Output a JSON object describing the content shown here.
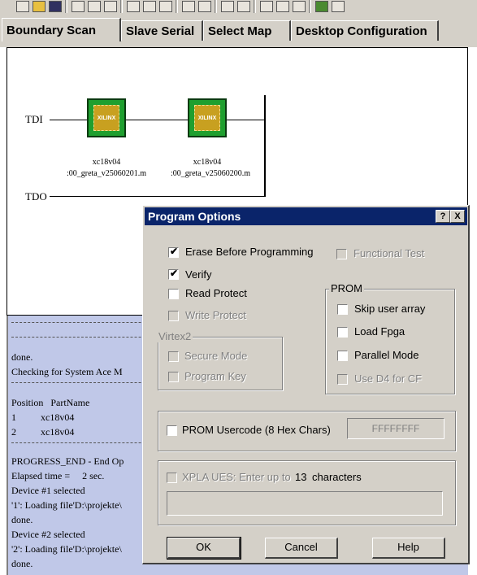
{
  "tabs": [
    "Boundary Scan",
    "Slave Serial",
    "Select Map",
    "Desktop Configuration"
  ],
  "chain": {
    "tdi": "TDI",
    "tdo": "TDO",
    "devices": [
      {
        "chip_logo": "XILINX",
        "part": "xc18v04",
        "file": ":00_greta_v25060201.m"
      },
      {
        "chip_logo": "XILINX",
        "part": "xc18v04",
        "file": ":00_greta_v25060200.m"
      }
    ]
  },
  "output": {
    "lines": [
      "done.",
      "Checking for System Ace M",
      "Position   PartName",
      "1          xc18v04",
      "2          xc18v04",
      "PROGRESS_END - End Op",
      "Elapsed time =     2 sec.",
      "Device #1 selected",
      "'1': Loading file'D:\\projekte\\",
      "done.",
      "Device #2 selected",
      "'2': Loading file'D:\\projekte\\",
      "done."
    ]
  },
  "dialog": {
    "title": "Program Options",
    "help_btn": "?",
    "close_btn": "X",
    "erase": {
      "label": "Erase Before Programming",
      "checked": true
    },
    "functional_test": {
      "label": "Functional Test",
      "checked": false
    },
    "verify": {
      "label": "Verify",
      "checked": true
    },
    "read_protect": {
      "label": "Read Protect",
      "checked": false
    },
    "write_protect": {
      "label": "Write Protect",
      "checked": false
    },
    "virtex2": {
      "title": "Virtex2",
      "secure_mode": "Secure Mode",
      "program_key": "Program Key"
    },
    "prom": {
      "title": "PROM",
      "skip_user_array": "Skip user array",
      "load_fpga": "Load Fpga",
      "parallel_mode": "Parallel Mode",
      "use_d4": "Use D4 for CF"
    },
    "prom_usercode": {
      "label": "PROM Usercode (8 Hex Chars)",
      "value": "FFFFFFFF"
    },
    "xpla": {
      "label": "XPLA UES: Enter up to",
      "count": "13",
      "suffix": "characters",
      "value": ""
    },
    "buttons": {
      "ok": "OK",
      "cancel": "Cancel",
      "help": "Help"
    }
  }
}
